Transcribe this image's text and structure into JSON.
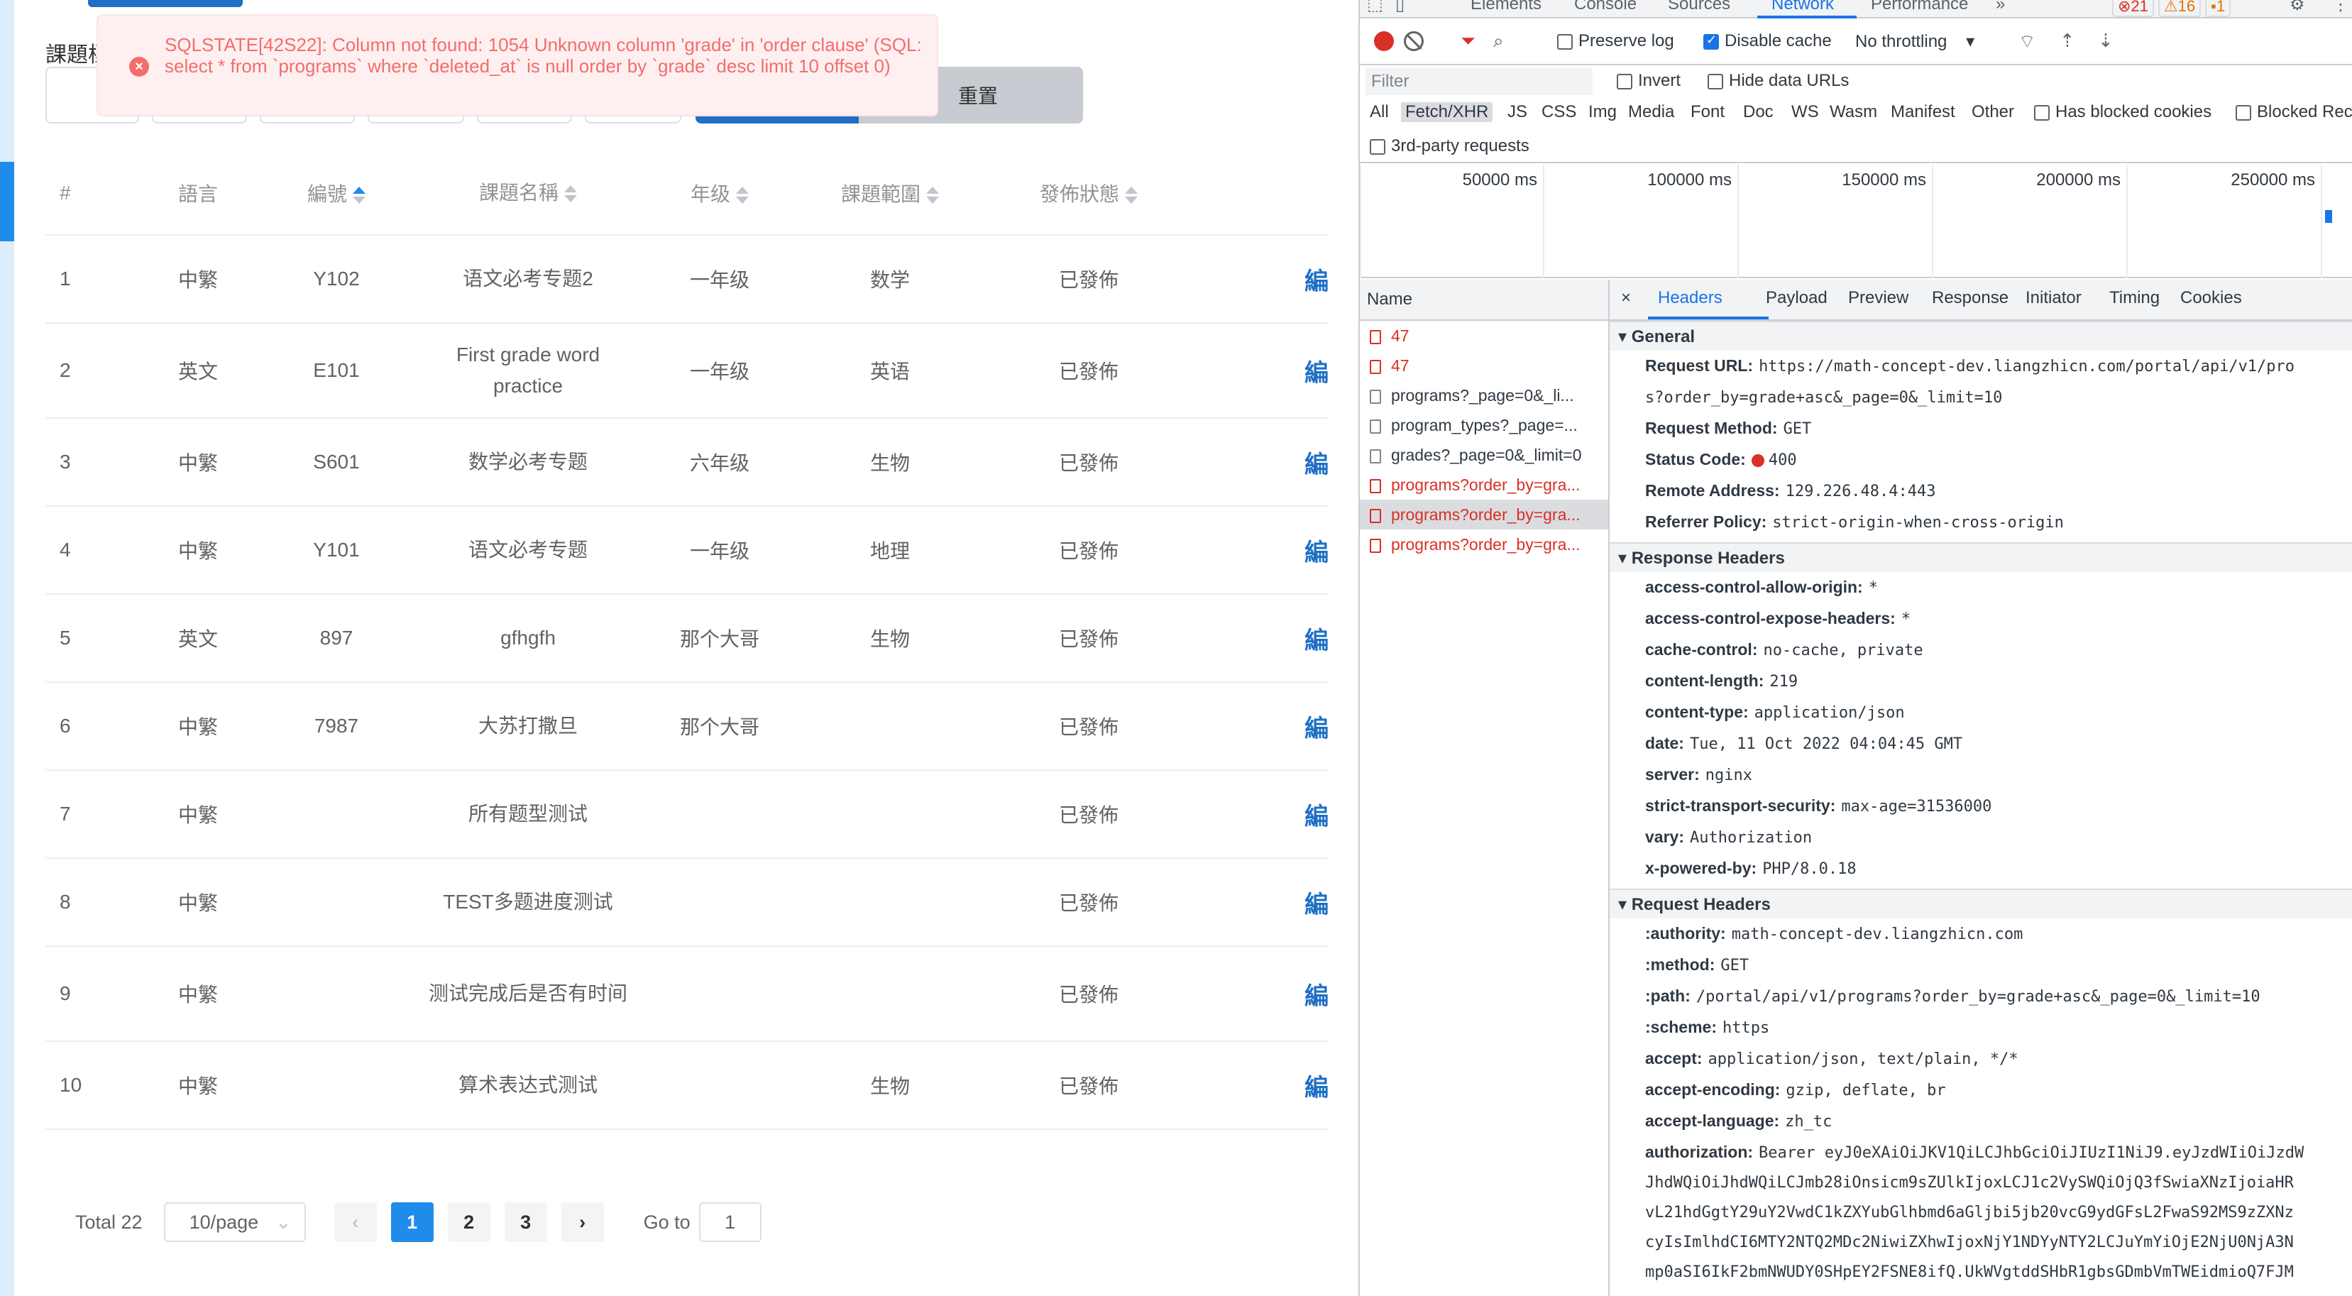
{
  "app": {
    "filter_title": "課題標",
    "reset_label": "重置",
    "error": {
      "message": "SQLSTATE[42S22]: Column not found: 1054 Unknown column 'grade' in 'order clause' (SQL: select * from `programs` where `deleted_at` is null order by `grade` desc limit 10 offset 0)"
    },
    "table": {
      "headers": [
        "#",
        "語言",
        "編號",
        "課題名稱",
        "年级",
        "課題範圍",
        "發佈狀態"
      ],
      "edit_label": "編",
      "rows": [
        {
          "n": "1",
          "lang": "中繁",
          "code": "Y102",
          "name": "语文必考专题2",
          "grade": "一年级",
          "scope": "数学",
          "status": "已發佈"
        },
        {
          "n": "2",
          "lang": "英文",
          "code": "E101",
          "name": "First grade word practice",
          "grade": "一年级",
          "scope": "英语",
          "status": "已發佈"
        },
        {
          "n": "3",
          "lang": "中繁",
          "code": "S601",
          "name": "数学必考专题",
          "grade": "六年级",
          "scope": "生物",
          "status": "已發佈"
        },
        {
          "n": "4",
          "lang": "中繁",
          "code": "Y101",
          "name": "语文必考专题",
          "grade": "一年级",
          "scope": "地理",
          "status": "已發佈"
        },
        {
          "n": "5",
          "lang": "英文",
          "code": "897",
          "name": "gfhgfh",
          "grade": "那个大哥",
          "scope": "生物",
          "status": "已發佈"
        },
        {
          "n": "6",
          "lang": "中繁",
          "code": "7987",
          "name": "大苏打撒旦",
          "grade": "那个大哥",
          "scope": "",
          "status": "已發佈"
        },
        {
          "n": "7",
          "lang": "中繁",
          "code": "",
          "name": "所有题型测试",
          "grade": "",
          "scope": "",
          "status": "已發佈"
        },
        {
          "n": "8",
          "lang": "中繁",
          "code": "",
          "name": "TEST多题进度测试",
          "grade": "",
          "scope": "",
          "status": "已發佈"
        },
        {
          "n": "9",
          "lang": "中繁",
          "code": "",
          "name": "测试完成后是否有时间",
          "grade": "",
          "scope": "",
          "status": "已發佈"
        },
        {
          "n": "10",
          "lang": "中繁",
          "code": "",
          "name": "算术表达式测试",
          "grade": "",
          "scope": "生物",
          "status": "已發佈"
        }
      ]
    },
    "pagination": {
      "total": "Total 22",
      "page_size": "10/page",
      "pages": [
        "1",
        "2",
        "3"
      ],
      "current": "1",
      "goto_label": "Go to",
      "goto_value": "1"
    }
  },
  "devtools": {
    "tabs": [
      "Elements",
      "Console",
      "Sources",
      "Network",
      "Performance",
      "»"
    ],
    "active_tab": "Network",
    "badges": {
      "errors": "21",
      "warnings": "16",
      "info": "1"
    },
    "toolbar": {
      "preserve_log": "Preserve log",
      "disable_cache": "Disable cache",
      "throttling": "No throttling"
    },
    "filter": {
      "placeholder": "Filter",
      "invert": "Invert",
      "hide_data_urls": "Hide data URLs"
    },
    "types": [
      "All",
      "Fetch/XHR",
      "JS",
      "CSS",
      "Img",
      "Media",
      "Font",
      "Doc",
      "WS",
      "Wasm",
      "Manifest",
      "Other"
    ],
    "has_blocked_cookies": "Has blocked cookies",
    "blocked_requests": "Blocked Rec",
    "third_party": "3rd-party requests",
    "timeline_ticks": [
      "50000 ms",
      "100000 ms",
      "150000 ms",
      "200000 ms",
      "250000 ms"
    ],
    "name_header": "Name",
    "requests": [
      {
        "name": "47",
        "error": true,
        "selected": false
      },
      {
        "name": "47",
        "error": true,
        "selected": false
      },
      {
        "name": "programs?_page=0&_li...",
        "error": false,
        "selected": false
      },
      {
        "name": "program_types?_page=...",
        "error": false,
        "selected": false
      },
      {
        "name": "grades?_page=0&_limit=0",
        "error": false,
        "selected": false
      },
      {
        "name": "programs?order_by=gra...",
        "error": true,
        "selected": false
      },
      {
        "name": "programs?order_by=gra...",
        "error": true,
        "selected": true
      },
      {
        "name": "programs?order_by=gra...",
        "error": true,
        "selected": false
      }
    ],
    "detail_tabs": [
      "×",
      "Headers",
      "Payload",
      "Preview",
      "Response",
      "Initiator",
      "Timing",
      "Cookies"
    ],
    "general": {
      "title": "General",
      "request_url_label": "Request URL:",
      "request_url_1": "https://math-concept-dev.liangzhicn.com/portal/api/v1/pro",
      "request_url_2": "s?order_by=grade+asc&_page=0&_limit=10",
      "method_label": "Request Method:",
      "method": "GET",
      "status_label": "Status Code:",
      "status": "400",
      "remote_label": "Remote Address:",
      "remote": "129.226.48.4:443",
      "referrer_label": "Referrer Policy:",
      "referrer": "strict-origin-when-cross-origin"
    },
    "response_headers": {
      "title": "Response Headers",
      "items": [
        {
          "k": "access-control-allow-origin:",
          "v": "*"
        },
        {
          "k": "access-control-expose-headers:",
          "v": "*"
        },
        {
          "k": "cache-control:",
          "v": "no-cache, private"
        },
        {
          "k": "content-length:",
          "v": "219"
        },
        {
          "k": "content-type:",
          "v": "application/json"
        },
        {
          "k": "date:",
          "v": "Tue, 11 Oct 2022 04:04:45 GMT"
        },
        {
          "k": "server:",
          "v": "nginx"
        },
        {
          "k": "strict-transport-security:",
          "v": "max-age=31536000"
        },
        {
          "k": "vary:",
          "v": "Authorization"
        },
        {
          "k": "x-powered-by:",
          "v": "PHP/8.0.18"
        }
      ]
    },
    "request_headers": {
      "title": "Request Headers",
      "items": [
        {
          "k": ":authority:",
          "v": "math-concept-dev.liangzhicn.com"
        },
        {
          "k": ":method:",
          "v": "GET"
        },
        {
          "k": ":path:",
          "v": "/portal/api/v1/programs?order_by=grade+asc&_page=0&_limit=10"
        },
        {
          "k": ":scheme:",
          "v": "https"
        },
        {
          "k": "accept:",
          "v": "application/json, text/plain, */*"
        },
        {
          "k": "accept-encoding:",
          "v": "gzip, deflate, br"
        },
        {
          "k": "accept-language:",
          "v": "zh_tc"
        },
        {
          "k": "authorization:",
          "v": "Bearer eyJ0eXAiOiJKV1QiLCJhbGciOiJIUzI1NiJ9.eyJzdWIiOiJzdW"
        }
      ],
      "auth_continuation": [
        "JhdWQiOiJhdWQiLCJmb28iOnsicm9sZUlkIjoxLCJ1c2VySWQiOjQ3fSwiaXNzIjoiaHR",
        "vL21hdGgtY29uY2VwdC1kZXYubGlhbmd6aGljbi5jb20vcG9ydGFsL2FwaS92MS9zZXNz",
        "cyIsImlhdCI6MTY2NTQ2MDc2NiwiZXhwIjoxNjY1NDYyNTY2LCJuYmYiOjE2NjU0NjA3N",
        "mp0aSI6IkF2bmNWUDY0SHpEY2FSNE8ifQ.UkWVgtddSHbR1gbsGDmbVmTWEidmioQ7FJM"
      ]
    }
  }
}
